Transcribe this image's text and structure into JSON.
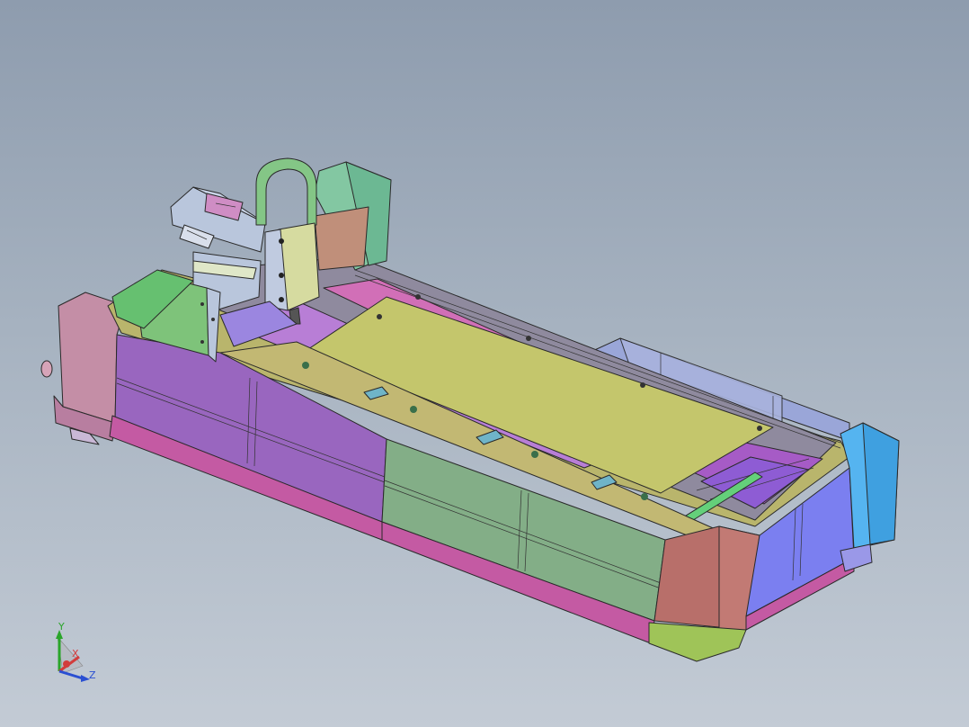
{
  "viewport": {
    "background_top": "#8e9cae",
    "background_bottom": "#c3cbd5"
  },
  "model": {
    "colors": {
      "front_left_panel": "#9966bf",
      "front_right_panel": "#83ae87",
      "base_strip": "#c45aa3",
      "worktable": "#c4c66c",
      "end_block": "#b86f6a",
      "right_cabinet": "#7b7ff0",
      "cyan_cap": "#55b4f0",
      "gantry_body": "#b9c6dc",
      "gantry_green": "#7ec37a",
      "left_end_cap": "#c48ea6",
      "rail_olive": "#b9b56c"
    }
  },
  "triad": {
    "y_label": "Y",
    "x_label": "X",
    "z_label": "Z",
    "y_color": "#2aa52a",
    "x_color": "#d23c3c",
    "z_color": "#2a4fd2"
  }
}
